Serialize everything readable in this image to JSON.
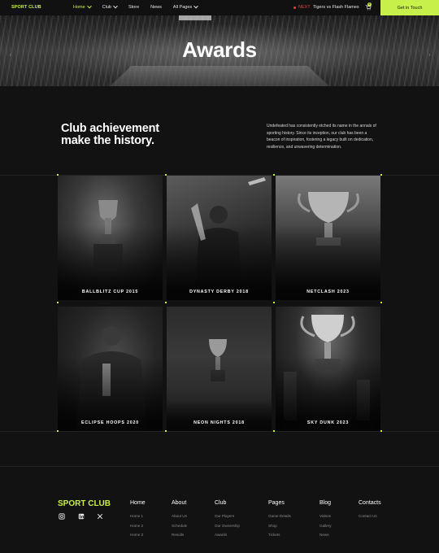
{
  "nav": {
    "logo": "SPORT CLUB",
    "menu": [
      "Home",
      "Club",
      "Store",
      "News",
      "All Pages"
    ],
    "next_label": "NEXT",
    "next_match": "Tigers vs Flash Flames",
    "cart_count": "0",
    "cta": "Get in Touch"
  },
  "hero": {
    "title": "Awards"
  },
  "intro": {
    "title": "Club achievement make the history.",
    "text": "Undefeated has consistently etched its name in the annals of sporting history. Since its inception, our club has been a beacon of inspiration, fostering a legacy built on dedication, resilience, and unwavering determination."
  },
  "awards": [
    {
      "caption": "BALLBLITZ CUP 2015"
    },
    {
      "caption": "DYNASTY DERBY 2018"
    },
    {
      "caption": "NETCLASH 2023"
    },
    {
      "caption": "ECLIPSE HOOPS 2020"
    },
    {
      "caption": "NEON NIGHTS 2018"
    },
    {
      "caption": "SKY DUNK 2023"
    }
  ],
  "footer": {
    "logo": "SPORT CLUB",
    "social": [
      "instagram-icon",
      "linkedin-icon",
      "x-icon"
    ],
    "columns": [
      {
        "title": "Home",
        "links": [
          "Home 1",
          "Home 2",
          "Home 3"
        ]
      },
      {
        "title": "About",
        "links": [
          "About Us",
          "Schedule",
          "Results"
        ]
      },
      {
        "title": "Club",
        "links": [
          "Our Players",
          "Our Ownership",
          "Awards"
        ]
      },
      {
        "title": "Pages",
        "links": [
          "Game Details",
          "Shop",
          "Tickets"
        ]
      },
      {
        "title": "Blog",
        "links": [
          "Videos",
          "Gallery",
          "News"
        ]
      },
      {
        "title": "Contacts",
        "links": [
          "Contact Us"
        ]
      }
    ]
  },
  "colors": {
    "accent": "#c8f04a",
    "background": "#121212",
    "next_red": "#e34040"
  }
}
